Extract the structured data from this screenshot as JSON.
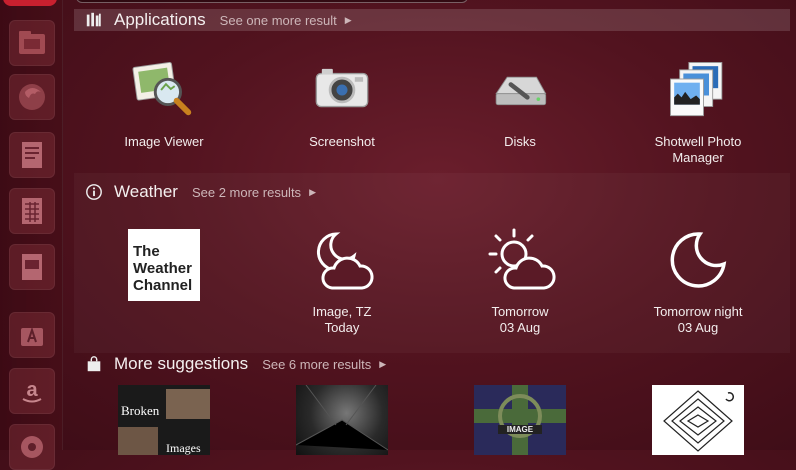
{
  "applications": {
    "title": "Applications",
    "more": "See one more result",
    "items": [
      {
        "label": "Image Viewer",
        "icon": "image-viewer-icon"
      },
      {
        "label": "Screenshot",
        "icon": "camera-icon"
      },
      {
        "label": "Disks",
        "icon": "disks-icon"
      },
      {
        "label": "Shotwell Photo",
        "label2": "Manager",
        "icon": "photo-manager-icon"
      }
    ]
  },
  "weather": {
    "title": "Weather",
    "more": "See 2 more results",
    "items": [
      {
        "label": "",
        "logo_text": [
          "The",
          "Weather",
          "Channel"
        ],
        "icon": "weather-channel-logo"
      },
      {
        "label": "Image, TZ",
        "label2": "Today",
        "icon": "moon-cloud-icon"
      },
      {
        "label": "Tomorrow",
        "label2": "03 Aug",
        "icon": "sun-cloud-icon"
      },
      {
        "label": "Tomorrow night",
        "label2": "03 Aug",
        "icon": "moon-icon"
      }
    ]
  },
  "suggestions": {
    "title": "More suggestions",
    "more": "See 6 more results",
    "items": [
      {
        "text": "Broken",
        "text2": "Images",
        "icon": "album-broken-images"
      },
      {
        "icon": "album-dark-cover"
      },
      {
        "text": "IMAGE",
        "icon": "album-celtic-cross"
      },
      {
        "icon": "album-maze"
      }
    ]
  },
  "colors": {
    "accent": "#c8202f",
    "background": "#52131f"
  }
}
